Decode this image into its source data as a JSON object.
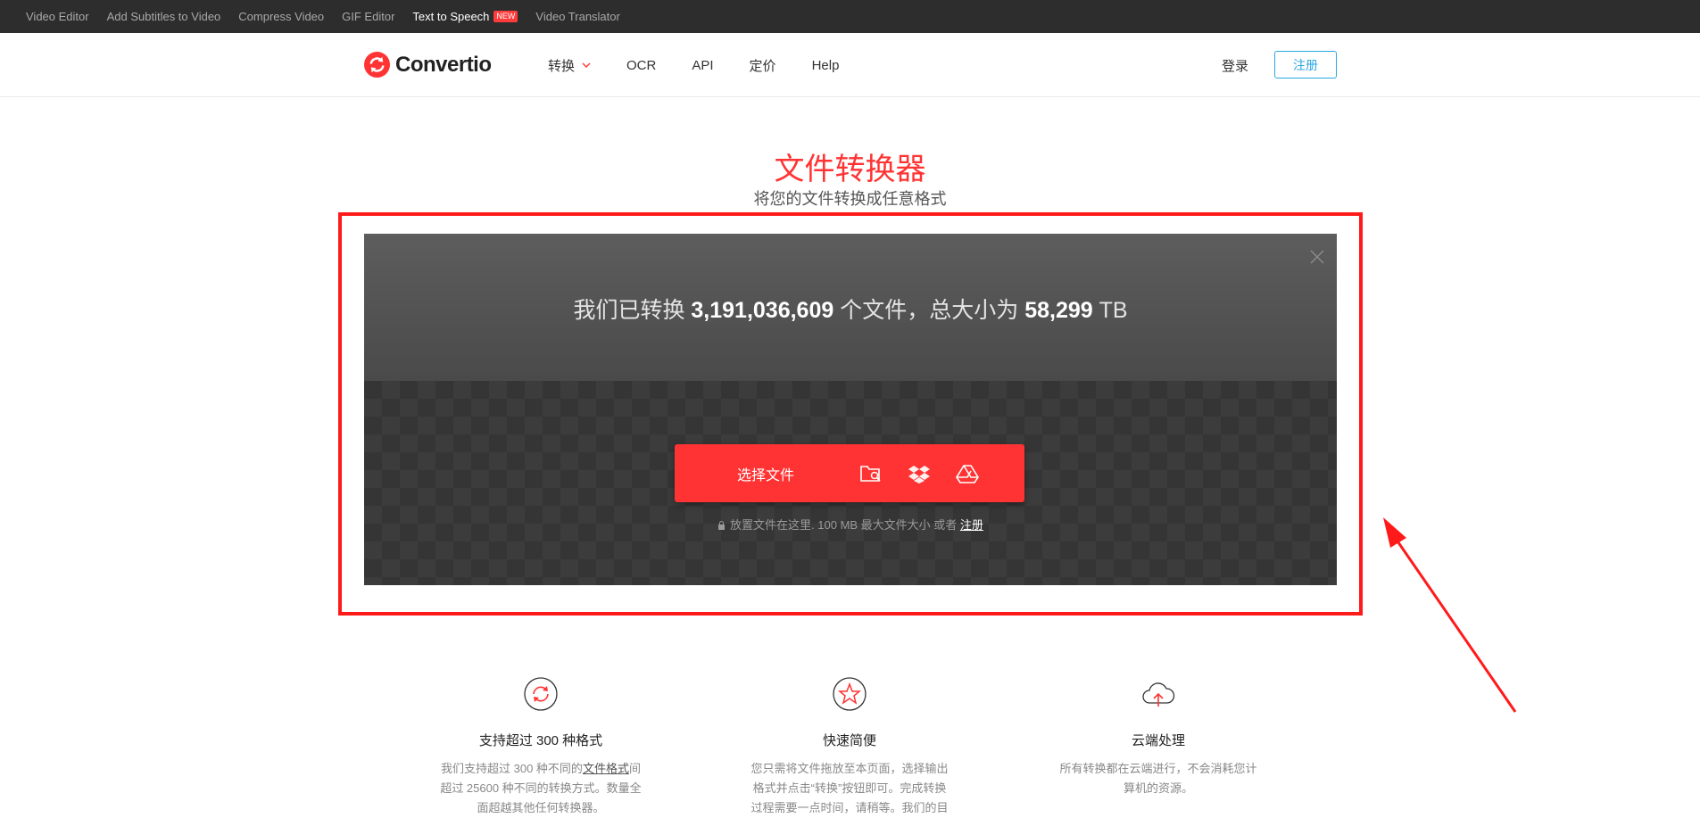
{
  "topbar": {
    "links": [
      "Video Editor",
      "Add Subtitles to Video",
      "Compress Video",
      "GIF Editor",
      "Text to Speech",
      "Video Translator"
    ],
    "new_badge": "NEW"
  },
  "header": {
    "logo_text": "Convertio",
    "nav": [
      "转换",
      "OCR",
      "API",
      "定价",
      "Help"
    ],
    "login": "登录",
    "register": "注册"
  },
  "hero": {
    "title": "文件转换器",
    "subtitle": "将您的文件转换成任意格式"
  },
  "converter": {
    "stats_prefix": "我们已转换 ",
    "files_count": "3,191,036,609",
    "stats_mid": " 个文件，总大小为 ",
    "total_size": "58,299",
    "size_unit": " TB",
    "choose_label": "选择文件",
    "hint_text": "放置文件在这里. 100 MB 最大文件大小 或者",
    "hint_link": "注册"
  },
  "features": [
    {
      "title": "支持超过 300 种格式",
      "text_a": "我们支持超过 300 种不同的",
      "text_link": "文件格式",
      "text_b": "间超过 25600 种不同的转换方式。数量全面超越其他任何转换器。"
    },
    {
      "title": "快速简便",
      "text": "您只需将文件拖放至本页面，选择输出格式并点击“转换”按钮即可。完成转换过程需要一点时间，请稍等。我们的目"
    },
    {
      "title": "云端处理",
      "text": "所有转换都在云端进行，不会消耗您计算机的资源。"
    }
  ],
  "colors": {
    "brand": "#ff3333",
    "topbar": "#2d2d2d",
    "register": "#2ba8e0",
    "annotation": "#ff1a1a"
  }
}
